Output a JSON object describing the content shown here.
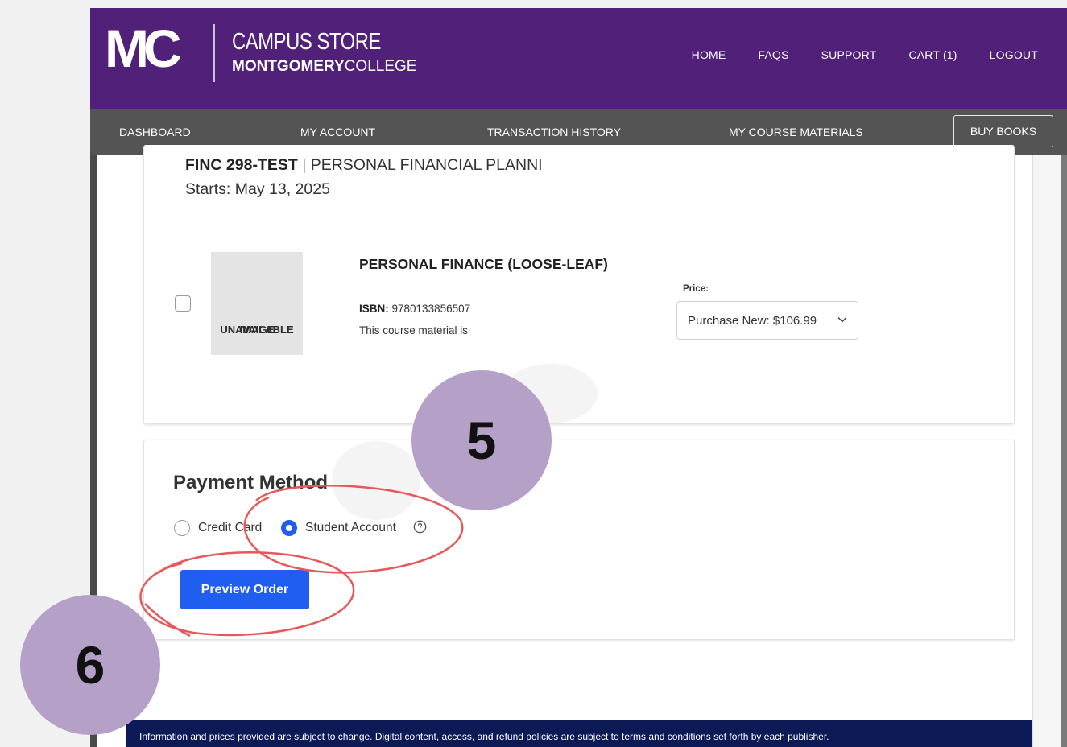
{
  "header": {
    "logo_mark": "MC",
    "store_line1": "CAMPUS STORE",
    "store_line2_bold": "MONTGOMERY",
    "store_line2_rest": "COLLEGE",
    "nav": [
      "HOME",
      "FAQS",
      "SUPPORT",
      "CART (1)",
      "LOGOUT"
    ]
  },
  "subnav": {
    "items": [
      "DASHBOARD",
      "MY ACCOUNT",
      "TRANSACTION HISTORY",
      "MY COURSE MATERIALS"
    ],
    "buy_books": "BUY BOOKS"
  },
  "course": {
    "code": "FINC 298-TEST",
    "separator": "|",
    "name": "PERSONAL FINANCIAL PLANNI",
    "starts": "Starts: May 13, 2025"
  },
  "book": {
    "image_text_line1": "IMAGE",
    "image_text_line2": "UNAVAILABLE",
    "title": "PERSONAL FINANCE (LOOSE-LEAF)",
    "isbn_label": "ISBN:",
    "isbn": "9780133856507",
    "note": "This course material is",
    "price_label": "Price:",
    "price_option": "Purchase New: $106.99"
  },
  "payment": {
    "title": "Payment Method",
    "options": [
      "Credit Card",
      "Student Account"
    ],
    "selected": "Student Account",
    "preview_button": "Preview Order"
  },
  "annotations": {
    "step5": "5",
    "step6": "6",
    "highlight_color": "#e8575a",
    "badge_color": "#b5a0c8"
  },
  "footer": {
    "text": "Information and prices provided are subject to change. Digital content, access, and refund policies are subject to terms and conditions set forth by each publisher."
  },
  "colors": {
    "header_purple": "#51217a",
    "subnav_gray": "#545454",
    "primary_blue": "#1f5ef0",
    "footer_navy": "#0e1a56"
  }
}
